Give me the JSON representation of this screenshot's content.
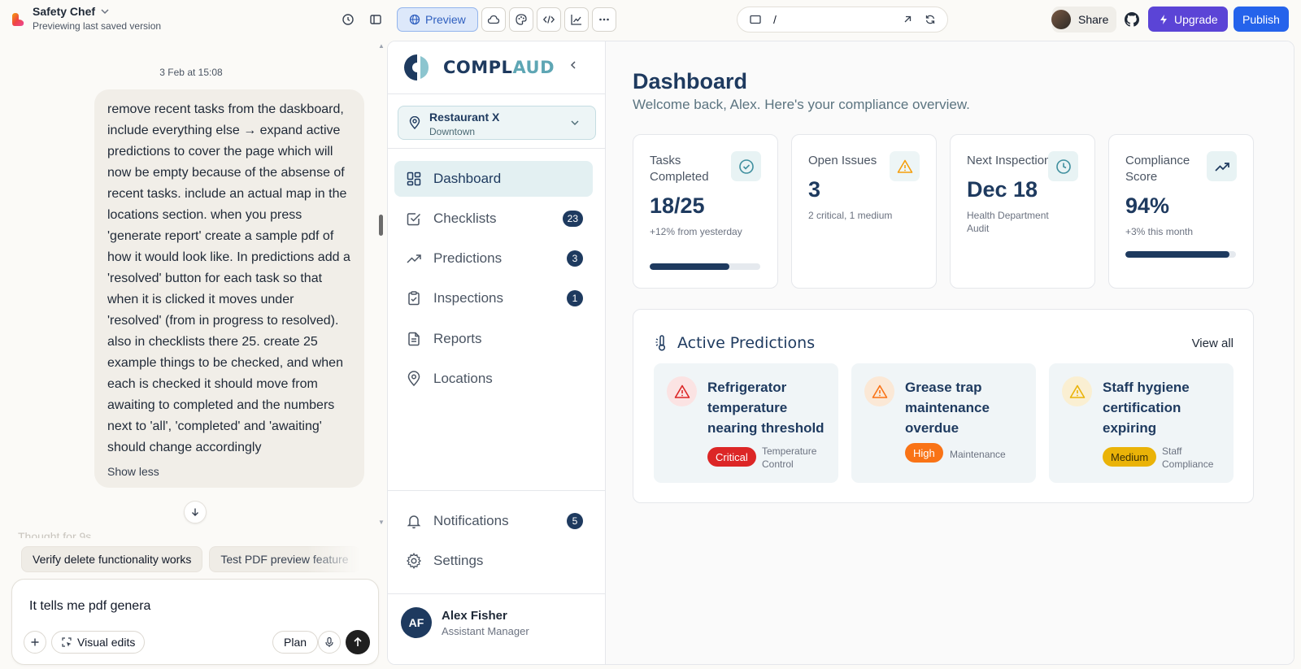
{
  "app": {
    "name": "Safety Chef",
    "subtitle": "Previewing last saved version"
  },
  "toolbar": {
    "preview_label": "Preview",
    "url_path": "/",
    "share_label": "Share",
    "upgrade_label": "Upgrade",
    "publish_label": "Publish"
  },
  "chat": {
    "timestamp": "3 Feb at 15:08",
    "message": "remove recent tasks from the daskboard, include everything else → expand active predictions to cover the page which will now be empty because of the absense of recent tasks. include an actual map in the locations section. when you press 'generate report' create a sample pdf of how it would look like. In predictions add a 'resolved' button for each task so that when it is clicked it moves under 'resolved' (from in progress to resolved). also in checklists there 25. create 25 example things to be checked, and when each is checked it should move from awaiting to completed and the numbers next to 'all', 'completed' and 'awaiting' should change accordingly",
    "show_less": "Show less",
    "thought": "Thought for 9s",
    "suggestions": [
      "Verify delete functionality works",
      "Test PDF preview feature"
    ],
    "composer_text": "It tells me pdf genera",
    "visual_edits_label": "Visual edits",
    "plan_label": "Plan"
  },
  "sidebar": {
    "brand_main": "COMPL",
    "brand_accent": "AUD",
    "location": {
      "name": "Restaurant X",
      "area": "Downtown"
    },
    "nav": [
      {
        "label": "Dashboard",
        "badge": ""
      },
      {
        "label": "Checklists",
        "badge": "23"
      },
      {
        "label": "Predictions",
        "badge": "3"
      },
      {
        "label": "Inspections",
        "badge": "1"
      },
      {
        "label": "Reports",
        "badge": ""
      },
      {
        "label": "Locations",
        "badge": ""
      }
    ],
    "bottom_nav": [
      {
        "label": "Notifications",
        "badge": "5"
      },
      {
        "label": "Settings",
        "badge": ""
      }
    ],
    "user": {
      "initials": "AF",
      "name": "Alex Fisher",
      "role": "Assistant Manager"
    }
  },
  "dashboard": {
    "title": "Dashboard",
    "subtitle": "Welcome back, Alex. Here's your compliance overview.",
    "stats": [
      {
        "label": "Tasks Completed",
        "value": "18/25",
        "note": "+12% from yesterday",
        "progress": 0.72
      },
      {
        "label": "Open Issues",
        "value": "3",
        "note": "2 critical, 1 medium"
      },
      {
        "label": "Next Inspection",
        "value": "Dec 18",
        "note": "Health Department Audit"
      },
      {
        "label": "Compliance Score",
        "value": "94%",
        "note": "+3% this month",
        "progress": 0.94
      }
    ],
    "predictions": {
      "title": "Active Predictions",
      "view_all": "View all",
      "items": [
        {
          "title": "Refrigerator temperature nearing threshold",
          "severity": "Critical",
          "category": "Temperature Control",
          "color": "#dc2626"
        },
        {
          "title": "Grease trap maintenance overdue",
          "severity": "High",
          "category": "Maintenance",
          "color": "#f97316"
        },
        {
          "title": "Staff hygiene certification expiring",
          "severity": "Medium",
          "category": "Staff Compliance",
          "color": "#eab308"
        }
      ]
    }
  },
  "colors": {
    "brand_navy": "#1e3a5f",
    "brand_teal": "#5ea6b4",
    "upgrade": "#5b44d6",
    "publish": "#2563eb"
  }
}
